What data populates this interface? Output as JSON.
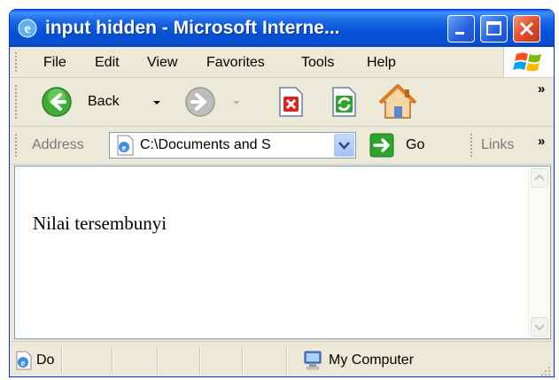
{
  "window": {
    "title": "input hidden - Microsoft Interne..."
  },
  "menu": {
    "items": [
      "File",
      "Edit",
      "View",
      "Favorites",
      "Tools",
      "Help"
    ]
  },
  "toolbar": {
    "back_label": "Back",
    "more": "»"
  },
  "address": {
    "label": "Address",
    "value": "C:\\Documents and S",
    "go_label": "Go",
    "links_label": "Links",
    "more": "»"
  },
  "page": {
    "text": "Nilai tersembunyi"
  },
  "status": {
    "left_text": "Do",
    "zone_text": "My Computer"
  },
  "colors": {
    "titlebar": "#0553d8",
    "chrome": "#ece9d8",
    "close": "#e24a2a",
    "go_green": "#2ea32e"
  },
  "icons": [
    "ie-logo-icon",
    "minimize-icon",
    "maximize-icon",
    "close-icon",
    "windows-logo-icon",
    "back-icon",
    "forward-icon",
    "stop-icon",
    "refresh-icon",
    "home-icon",
    "page-icon",
    "dropdown-icon",
    "go-arrow-icon",
    "my-computer-icon",
    "resize-grip-icon"
  ]
}
